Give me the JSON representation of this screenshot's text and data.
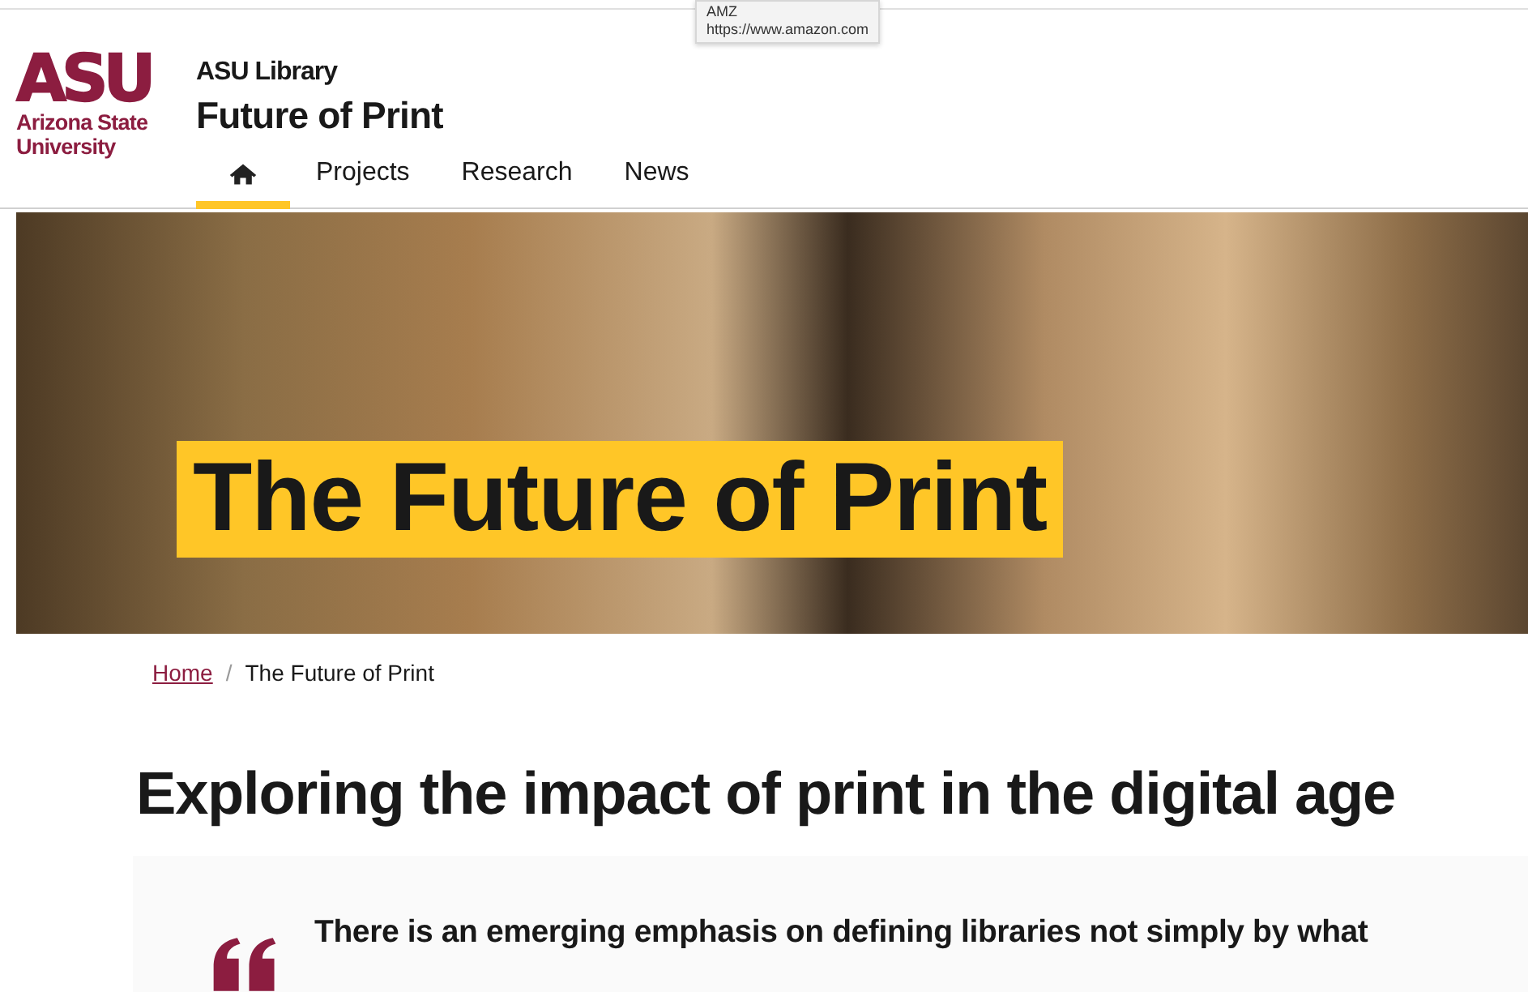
{
  "tooltip": {
    "title": "AMZ",
    "url": "https://www.amazon.com"
  },
  "logo": {
    "mark": "ASU",
    "name": "Arizona State University"
  },
  "header": {
    "parent": "ASU Library",
    "title": "Future of Print"
  },
  "nav": [
    {
      "kind": "home",
      "selected": true
    },
    {
      "kind": "link",
      "label": "Projects",
      "selected": false
    },
    {
      "kind": "link",
      "label": "Research",
      "selected": false
    },
    {
      "kind": "link",
      "label": "News",
      "selected": false
    }
  ],
  "hero": {
    "title": "The Future of Print"
  },
  "breadcrumb_separator": "/",
  "breadcrumb": [
    {
      "label": "Home",
      "link": true
    },
    {
      "label": "The Future of Print",
      "link": false
    }
  ],
  "heading": "Exploring the impact of print in the digital age",
  "quote": {
    "text": "There is an emerging emphasis on defining libraries not simply by what"
  }
}
